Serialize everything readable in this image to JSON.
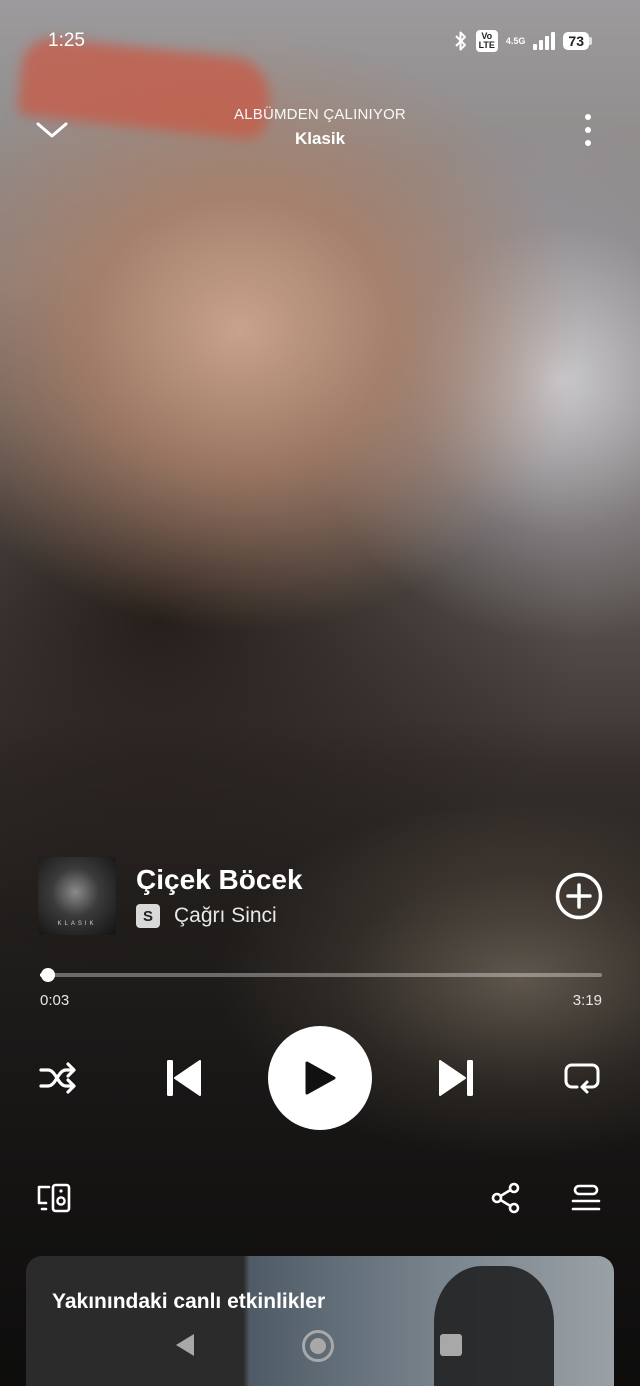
{
  "status_bar": {
    "time": "1:25",
    "volte_line1": "Vo",
    "volte_line2": "LTE",
    "network": "4.5G",
    "battery": "73"
  },
  "header": {
    "context_label": "ALBÜMDEN ÇALINIYOR",
    "context_name": "Klasik"
  },
  "track": {
    "title": "Çiçek Böcek",
    "badge": "S",
    "artist": "Çağrı Sinci",
    "cover_text": "KLASIK"
  },
  "progress": {
    "elapsed": "0:03",
    "duration": "3:19",
    "fraction": 0.015
  },
  "events_card": {
    "title": "Yakınındaki canlı etkinlikler"
  },
  "icons": {
    "collapse": "chevron-down-icon",
    "more": "more-vertical-icon",
    "add": "add-circle-icon",
    "shuffle": "shuffle-icon",
    "previous": "skip-previous-icon",
    "play": "play-icon",
    "next": "skip-next-icon",
    "repeat": "repeat-icon",
    "devices": "connect-device-icon",
    "share": "share-icon",
    "queue": "queue-icon"
  }
}
